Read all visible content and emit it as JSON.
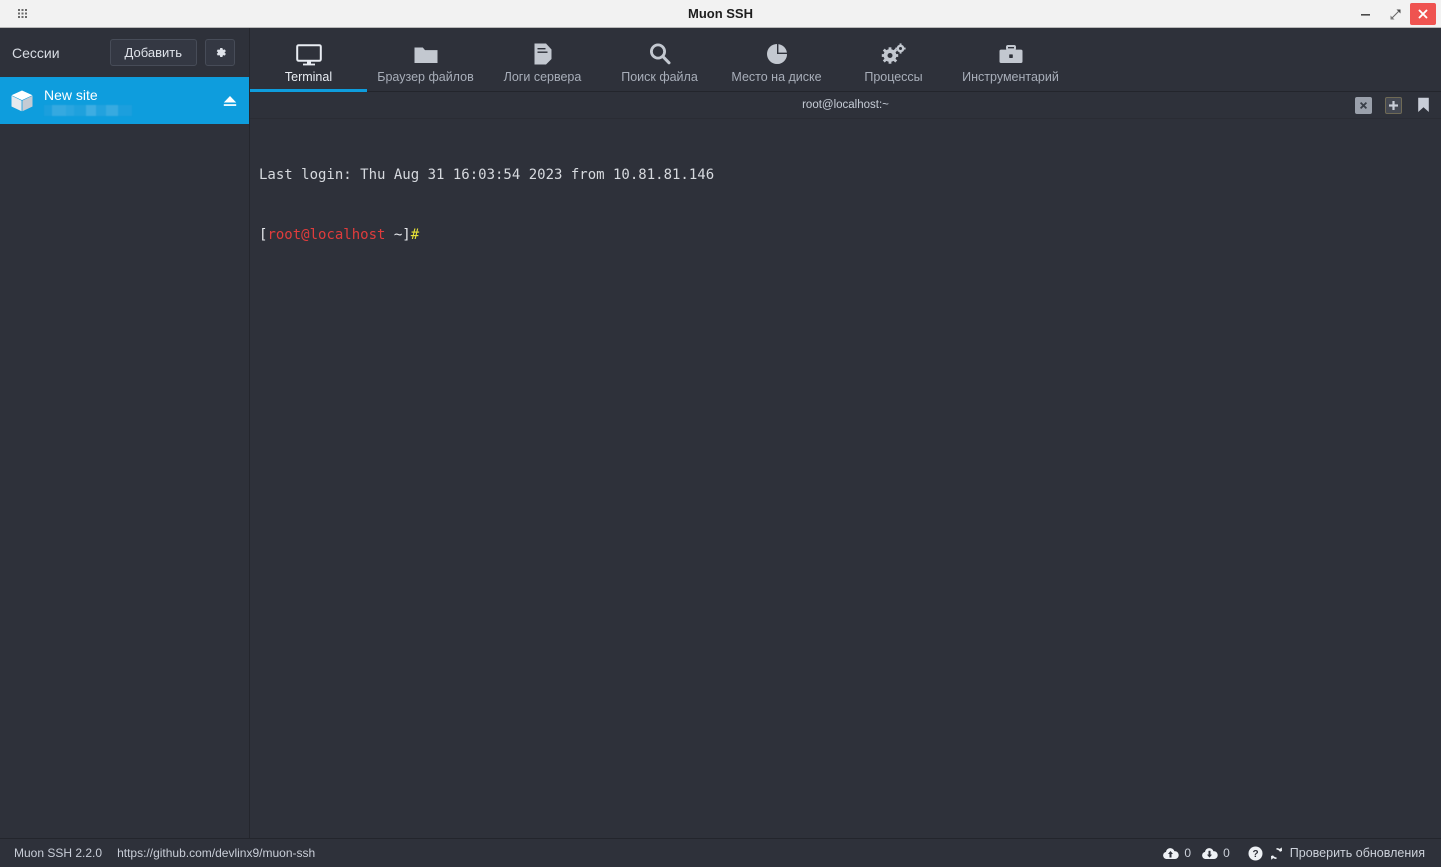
{
  "window": {
    "title": "Muon SSH",
    "menu_icon": "grid-dots-icon",
    "minimize_label": "–",
    "maximize_label": "restore-icon",
    "close_label": "✕"
  },
  "sidebar": {
    "title": "Сессии",
    "add_button": "Добавить",
    "settings_icon": "gear-icon",
    "sessions": [
      {
        "icon": "box-icon",
        "name": "New site",
        "subtitle_redacted": true,
        "action_icon": "eject-icon"
      }
    ]
  },
  "toolbar": {
    "tabs": [
      {
        "label": "Terminal",
        "icon": "monitor-icon",
        "active": true
      },
      {
        "label": "Браузер файлов",
        "icon": "folder-icon",
        "active": false
      },
      {
        "label": "Логи сервера",
        "icon": "file-icon",
        "active": false
      },
      {
        "label": "Поиск файла",
        "icon": "search-icon",
        "active": false
      },
      {
        "label": "Место на диске",
        "icon": "pie-chart-icon",
        "active": false
      },
      {
        "label": "Процессы",
        "icon": "gears-icon",
        "active": false
      },
      {
        "label": "Инструментарий",
        "icon": "briefcase-icon",
        "active": false
      }
    ]
  },
  "terminal_tabbar": {
    "title": "root@localhost:~",
    "close_icon": "close-icon",
    "new_tab_icon": "plus-icon",
    "bookmark_icon": "bookmark-icon"
  },
  "terminal": {
    "lines": [
      {
        "segments": [
          {
            "text": "Last login: Thu Aug 31 16:03:54 2023 from 10.81.81.146",
            "color": "default"
          }
        ]
      },
      {
        "segments": [
          {
            "text": "[",
            "color": "white"
          },
          {
            "text": "root@localhost",
            "color": "red"
          },
          {
            "text": " ~]",
            "color": "white"
          },
          {
            "text": "#",
            "color": "yellow"
          }
        ]
      }
    ]
  },
  "statusbar": {
    "version": "Muon SSH 2.2.0",
    "url": "https://github.com/devlinx9/muon-ssh",
    "upload_icon": "cloud-upload-icon",
    "upload_count": "0",
    "download_icon": "cloud-download-icon",
    "download_count": "0",
    "help_icon": "help-circle-icon",
    "refresh_icon": "refresh-icon",
    "update_label": "Проверить обновления"
  },
  "colors": {
    "accent": "#0e9ddd",
    "background": "#2e313a",
    "close_red": "#ef5350",
    "prompt_red": "#e03c3c",
    "prompt_yellow": "#e8e337"
  }
}
